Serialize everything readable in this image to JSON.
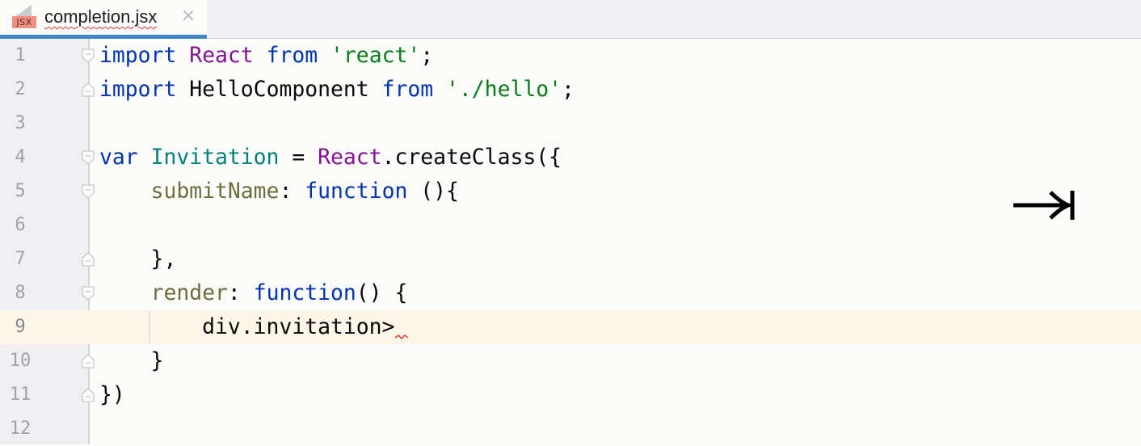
{
  "tab": {
    "file_type_badge": "JSX",
    "file_name": "completion.jsx",
    "close_glyph": "×",
    "icon": "jsx-file-icon",
    "active": true
  },
  "editor": {
    "current_line": 9,
    "lines": [
      {
        "n": "1",
        "fold": "start",
        "tokens": [
          {
            "t": "import",
            "c": "kw"
          },
          {
            "t": " ",
            "c": "plain"
          },
          {
            "t": "React",
            "c": "cls"
          },
          {
            "t": " ",
            "c": "plain"
          },
          {
            "t": "from",
            "c": "kw"
          },
          {
            "t": " ",
            "c": "plain"
          },
          {
            "t": "'react'",
            "c": "str"
          },
          {
            "t": ";",
            "c": "plain"
          }
        ]
      },
      {
        "n": "2",
        "fold": "end",
        "tokens": [
          {
            "t": "import",
            "c": "kw"
          },
          {
            "t": " HelloComponent ",
            "c": "plain"
          },
          {
            "t": "from",
            "c": "kw"
          },
          {
            "t": " ",
            "c": "plain"
          },
          {
            "t": "'./hello'",
            "c": "str"
          },
          {
            "t": ";",
            "c": "plain"
          }
        ]
      },
      {
        "n": "3",
        "fold": "",
        "tokens": []
      },
      {
        "n": "4",
        "fold": "start",
        "tokens": [
          {
            "t": "var",
            "c": "kw"
          },
          {
            "t": " ",
            "c": "plain"
          },
          {
            "t": "Invitation",
            "c": "var"
          },
          {
            "t": " = ",
            "c": "plain"
          },
          {
            "t": "React",
            "c": "cls"
          },
          {
            "t": ".createClass({",
            "c": "plain"
          }
        ]
      },
      {
        "n": "5",
        "fold": "start",
        "tokens": [
          {
            "t": "    ",
            "c": "plain"
          },
          {
            "t": "submitName",
            "c": "prop"
          },
          {
            "t": ": ",
            "c": "plain"
          },
          {
            "t": "function",
            "c": "kw"
          },
          {
            "t": " (){",
            "c": "plain"
          }
        ]
      },
      {
        "n": "6",
        "fold": "",
        "tokens": []
      },
      {
        "n": "7",
        "fold": "end",
        "tokens": [
          {
            "t": "    },",
            "c": "plain"
          }
        ]
      },
      {
        "n": "8",
        "fold": "start",
        "tokens": [
          {
            "t": "    ",
            "c": "plain"
          },
          {
            "t": "render",
            "c": "prop"
          },
          {
            "t": ": ",
            "c": "plain"
          },
          {
            "t": "function",
            "c": "kw"
          },
          {
            "t": "() {",
            "c": "plain"
          }
        ]
      },
      {
        "n": "9",
        "fold": "",
        "tokens": [
          {
            "t": "        div.invitation>",
            "c": "plain"
          }
        ]
      },
      {
        "n": "10",
        "fold": "end",
        "tokens": [
          {
            "t": "    }",
            "c": "plain"
          }
        ]
      },
      {
        "n": "11",
        "fold": "end",
        "tokens": [
          {
            "t": "})",
            "c": "plain"
          }
        ]
      },
      {
        "n": "12",
        "fold": "",
        "tokens": []
      }
    ]
  },
  "overlay": {
    "hint_icon": "tab-key-icon",
    "hint_glyph": "⇥"
  },
  "colors": {
    "keyword": "#0033b3",
    "string": "#067d17",
    "class": "#871094",
    "variable": "#00817b",
    "property": "#6c6c3c",
    "active_tab_underline": "#3a86c8",
    "current_line_bg": "#fcf7e8",
    "error_squiggle": "#e53935"
  }
}
